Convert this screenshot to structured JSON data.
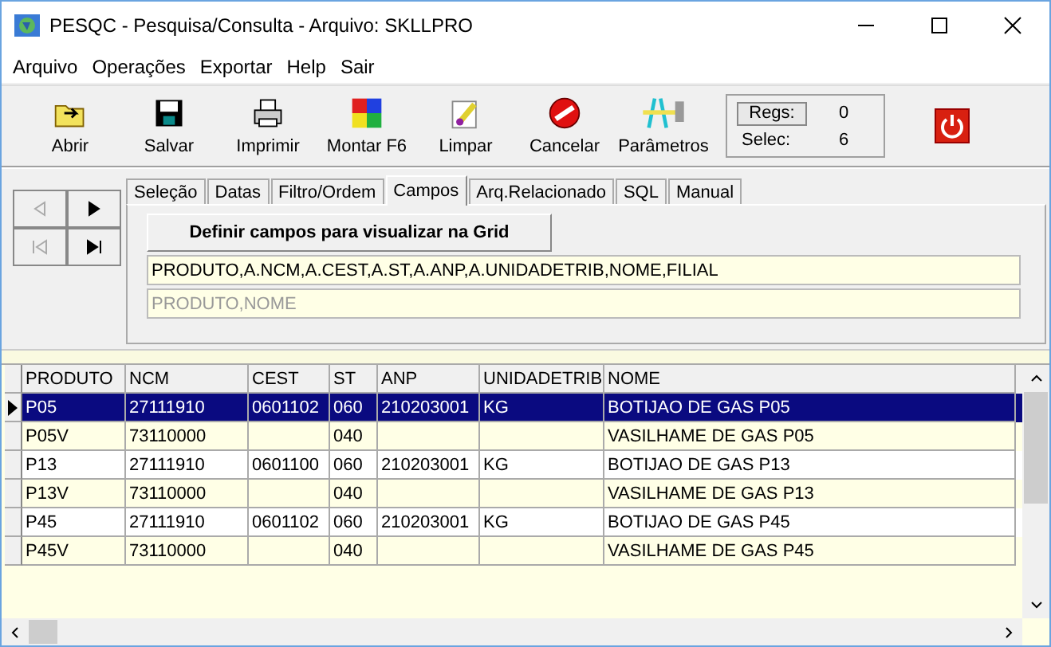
{
  "window": {
    "title": "PESQC  - Pesquisa/Consulta - Arquivo: SKLLPRO"
  },
  "menu": [
    "Arquivo",
    "Operações",
    "Exportar",
    "Help",
    "Sair"
  ],
  "toolbar": [
    {
      "label": "Abrir",
      "kind": "folder"
    },
    {
      "label": "Salvar",
      "kind": "disk"
    },
    {
      "label": "Imprimir",
      "kind": "printer"
    },
    {
      "label": "Montar F6",
      "kind": "puzzle"
    },
    {
      "label": "Limpar",
      "kind": "eraser"
    },
    {
      "label": "Cancelar",
      "kind": "cancel"
    },
    {
      "label": "Parâmetros",
      "kind": "tools"
    }
  ],
  "counters": {
    "regs_button": "Regs:",
    "regs_value": "0",
    "selec_label": "Selec:",
    "selec_value": "6"
  },
  "nav_buttons": [
    {
      "kind": "prev",
      "disabled": true
    },
    {
      "kind": "next",
      "disabled": false
    },
    {
      "kind": "first",
      "disabled": true
    },
    {
      "kind": "last",
      "disabled": false
    }
  ],
  "tabs": [
    {
      "label": "Seleção",
      "selected": false
    },
    {
      "label": "Datas",
      "selected": false
    },
    {
      "label": "Filtro/Ordem",
      "selected": false
    },
    {
      "label": "Campos",
      "selected": true
    },
    {
      "label": "Arq.Relacionado",
      "selected": false
    },
    {
      "label": "SQL",
      "selected": false
    },
    {
      "label": "Manual",
      "selected": false
    }
  ],
  "campos": {
    "button": "Definir campos para visualizar na Grid",
    "fields_value": "PRODUTO,A.NCM,A.CEST,A.ST,A.ANP,A.UNIDADETRIB,NOME,FILIAL",
    "order_value": "PRODUTO,NOME"
  },
  "table": {
    "columns": [
      "PRODUTO",
      "NCM",
      "CEST",
      "ST",
      "ANP",
      "UNIDADETRIB",
      "NOME"
    ],
    "rows": [
      {
        "selected": true,
        "cells": [
          "P05",
          "27111910",
          "0601102",
          "060",
          "210203001",
          "KG",
          "BOTIJAO DE GAS P05"
        ]
      },
      {
        "selected": false,
        "cells": [
          "P05V",
          "73110000",
          "",
          "040",
          "",
          "",
          "VASILHAME DE GAS P05"
        ]
      },
      {
        "selected": false,
        "cells": [
          "P13",
          "27111910",
          "0601100",
          "060",
          "210203001",
          "KG",
          "BOTIJAO DE GAS P13"
        ]
      },
      {
        "selected": false,
        "cells": [
          "P13V",
          "73110000",
          "",
          "040",
          "",
          "",
          "VASILHAME DE GAS P13"
        ]
      },
      {
        "selected": false,
        "cells": [
          "P45",
          "27111910",
          "0601102",
          "060",
          "210203001",
          "KG",
          "BOTIJAO DE GAS P45"
        ]
      },
      {
        "selected": false,
        "cells": [
          "P45V",
          "73110000",
          "",
          "040",
          "",
          "",
          "VASILHAME DE GAS P45"
        ]
      }
    ]
  }
}
